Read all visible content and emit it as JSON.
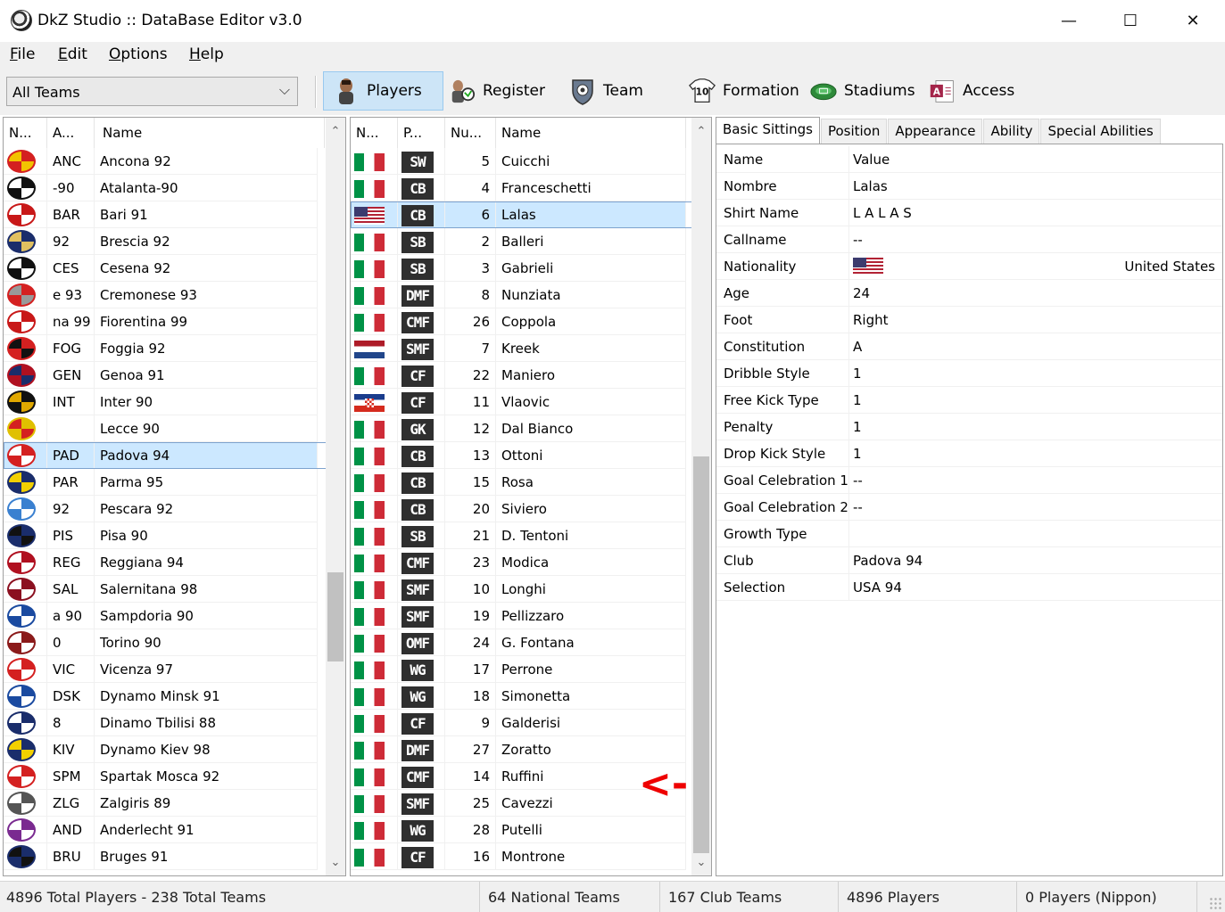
{
  "window": {
    "title": "DkZ Studio :: DataBase Editor v3.0",
    "minimize": "—",
    "maximize": "☐",
    "close": "✕"
  },
  "menu": [
    {
      "label": "File",
      "ul": "F",
      "rest": "ile"
    },
    {
      "label": "Edit",
      "ul": "E",
      "rest": "dit"
    },
    {
      "label": "Options",
      "ul": "O",
      "rest": "ptions"
    },
    {
      "label": "Help",
      "ul": "H",
      "rest": "elp"
    }
  ],
  "toolbar": {
    "team_filter": "All Teams",
    "players": "Players",
    "register": "Register",
    "team": "Team",
    "formation": "Formation",
    "formation_badge": "10",
    "stadiums": "Stadiums",
    "access": "Access"
  },
  "teams": {
    "headers": [
      "N...",
      "A...",
      "Name"
    ],
    "rows": [
      {
        "abbr": "ANC",
        "name": "Ancona 92",
        "c1": "#d42020",
        "c2": "#f2c300"
      },
      {
        "abbr": "-90",
        "name": "Atalanta-90",
        "c1": "#111111",
        "c2": "#ffffff"
      },
      {
        "abbr": "BAR",
        "name": "Bari 91",
        "c1": "#c81818",
        "c2": "#ffffff"
      },
      {
        "abbr": "92",
        "name": "Brescia 92",
        "c1": "#1a2d6b",
        "c2": "#e0c060"
      },
      {
        "abbr": "CES",
        "name": "Cesena 92",
        "c1": "#111111",
        "c2": "#ffffff"
      },
      {
        "abbr": "e 93",
        "name": "Cremonese 93",
        "c1": "#d42020",
        "c2": "#999999"
      },
      {
        "abbr": "na 99",
        "name": "Fiorentina 99",
        "c1": "#c81818",
        "c2": "#ffffff"
      },
      {
        "abbr": "FOG",
        "name": "Foggia 92",
        "c1": "#d42020",
        "c2": "#111111"
      },
      {
        "abbr": "GEN",
        "name": "Genoa 91",
        "c1": "#b01020",
        "c2": "#1a2d6b"
      },
      {
        "abbr": "INT",
        "name": "Inter 90",
        "c1": "#111111",
        "c2": "#e0a800"
      },
      {
        "abbr": "",
        "name": "Lecce 90",
        "c1": "#e0c000",
        "c2": "#d42020"
      },
      {
        "abbr": "PAD",
        "name": "Padova 94",
        "c1": "#d42020",
        "c2": "#ffffff"
      },
      {
        "abbr": "PAR",
        "name": "Parma 95",
        "c1": "#1a2d6b",
        "c2": "#f2d000"
      },
      {
        "abbr": "92",
        "name": "Pescara 92",
        "c1": "#3a80d0",
        "c2": "#ffffff"
      },
      {
        "abbr": "PIS",
        "name": "Pisa 90",
        "c1": "#1a2d6b",
        "c2": "#111111"
      },
      {
        "abbr": "REG",
        "name": "Reggiana 94",
        "c1": "#b01020",
        "c2": "#ffffff"
      },
      {
        "abbr": "SAL",
        "name": "Salernitana 98",
        "c1": "#8b1020",
        "c2": "#ffffff"
      },
      {
        "abbr": "a 90",
        "name": "Sampdoria 90",
        "c1": "#1a4aa0",
        "c2": "#ffffff"
      },
      {
        "abbr": "0",
        "name": "Torino 90",
        "c1": "#8b1a1a",
        "c2": "#ffffff"
      },
      {
        "abbr": "VIC",
        "name": "Vicenza 97",
        "c1": "#d42020",
        "c2": "#ffffff"
      },
      {
        "abbr": "DSK",
        "name": "Dynamo Minsk 91",
        "c1": "#1a4aa0",
        "c2": "#ffffff"
      },
      {
        "abbr": "8",
        "name": "Dinamo Tbilisi 88",
        "c1": "#1a2d6b",
        "c2": "#ffffff"
      },
      {
        "abbr": "KIV",
        "name": "Dynamo Kiev 98",
        "c1": "#1a2d6b",
        "c2": "#f2d000"
      },
      {
        "abbr": "SPM",
        "name": "Spartak Mosca 92",
        "c1": "#d42020",
        "c2": "#ffffff"
      },
      {
        "abbr": "ZLG",
        "name": "Zalgiris 89",
        "c1": "#555555",
        "c2": "#ffffff"
      },
      {
        "abbr": "AND",
        "name": "Anderlecht 91",
        "c1": "#7a2a90",
        "c2": "#ffffff"
      },
      {
        "abbr": "BRU",
        "name": "Bruges 91",
        "c1": "#1a2d6b",
        "c2": "#111111"
      }
    ],
    "selected_index": 11
  },
  "players": {
    "headers": [
      "N...",
      "P...",
      "Nu...",
      "Name"
    ],
    "rows": [
      {
        "flag": "it",
        "pos": "SW",
        "num": "5",
        "name": "Cuicchi"
      },
      {
        "flag": "it",
        "pos": "CB",
        "num": "4",
        "name": "Franceschetti"
      },
      {
        "flag": "us",
        "pos": "CB",
        "num": "6",
        "name": "Lalas"
      },
      {
        "flag": "it",
        "pos": "SB",
        "num": "2",
        "name": "Balleri"
      },
      {
        "flag": "it",
        "pos": "SB",
        "num": "3",
        "name": "Gabrieli"
      },
      {
        "flag": "it",
        "pos": "DMF",
        "num": "8",
        "name": "Nunziata"
      },
      {
        "flag": "it",
        "pos": "CMF",
        "num": "26",
        "name": "Coppola"
      },
      {
        "flag": "nl",
        "pos": "SMF",
        "num": "7",
        "name": "Kreek"
      },
      {
        "flag": "it",
        "pos": "CF",
        "num": "22",
        "name": "Maniero"
      },
      {
        "flag": "hr",
        "pos": "CF",
        "num": "11",
        "name": "Vlaovic"
      },
      {
        "flag": "it",
        "pos": "GK",
        "num": "12",
        "name": "Dal Bianco"
      },
      {
        "flag": "it",
        "pos": "CB",
        "num": "13",
        "name": "Ottoni"
      },
      {
        "flag": "it",
        "pos": "CB",
        "num": "15",
        "name": "Rosa"
      },
      {
        "flag": "it",
        "pos": "CB",
        "num": "20",
        "name": "Siviero"
      },
      {
        "flag": "it",
        "pos": "SB",
        "num": "21",
        "name": "D. Tentoni"
      },
      {
        "flag": "it",
        "pos": "CMF",
        "num": "23",
        "name": "Modica"
      },
      {
        "flag": "it",
        "pos": "SMF",
        "num": "10",
        "name": "Longhi"
      },
      {
        "flag": "it",
        "pos": "SMF",
        "num": "19",
        "name": "Pellizzaro"
      },
      {
        "flag": "it",
        "pos": "OMF",
        "num": "24",
        "name": "G. Fontana"
      },
      {
        "flag": "it",
        "pos": "WG",
        "num": "17",
        "name": "Perrone"
      },
      {
        "flag": "it",
        "pos": "WG",
        "num": "18",
        "name": "Simonetta"
      },
      {
        "flag": "it",
        "pos": "CF",
        "num": "9",
        "name": "Galderisi"
      },
      {
        "flag": "it",
        "pos": "DMF",
        "num": "27",
        "name": "Zoratto"
      },
      {
        "flag": "it",
        "pos": "CMF",
        "num": "14",
        "name": "Ruffini"
      },
      {
        "flag": "it",
        "pos": "SMF",
        "num": "25",
        "name": "Cavezzi"
      },
      {
        "flag": "it",
        "pos": "WG",
        "num": "28",
        "name": "Putelli"
      },
      {
        "flag": "it",
        "pos": "CF",
        "num": "16",
        "name": "Montrone"
      }
    ],
    "selected_index": 2
  },
  "tabs": [
    "Basic Sittings",
    "Position",
    "Appearance",
    "Ability",
    "Special Abilities"
  ],
  "properties": [
    {
      "key": "Name",
      "value": "Value"
    },
    {
      "key": "Nombre",
      "value": "Lalas"
    },
    {
      "key": "Shirt Name",
      "value": "L A L A S"
    },
    {
      "key": "Callname",
      "value": "--"
    },
    {
      "key": "Nationality",
      "value": "",
      "flag": "us",
      "right": "United States"
    },
    {
      "key": "Age",
      "value": "24"
    },
    {
      "key": "Foot",
      "value": "Right"
    },
    {
      "key": "Constitution",
      "value": "A"
    },
    {
      "key": "Dribble Style",
      "value": "1"
    },
    {
      "key": "Free Kick Type",
      "value": "1"
    },
    {
      "key": "Penalty",
      "value": "1"
    },
    {
      "key": "Drop Kick Style",
      "value": "1"
    },
    {
      "key": "Goal Celebration 1",
      "value": "--"
    },
    {
      "key": "Goal Celebration 2",
      "value": "--"
    },
    {
      "key": "Growth Type",
      "value": ""
    },
    {
      "key": "Club",
      "value": "Padova 94"
    },
    {
      "key": "Selection",
      "value": "USA 94"
    }
  ],
  "status": {
    "totals": "4896 Total Players  -  238 Total Teams",
    "national": "64 National Teams",
    "club": "167 Club Teams",
    "players": "4896 Players",
    "nippon": "0 Players (Nippon)"
  },
  "annotation": "<-",
  "colors": {
    "selection": "#cce8ff",
    "active_tool": "#cde5f7",
    "position_badge": "#2f2f2f"
  }
}
